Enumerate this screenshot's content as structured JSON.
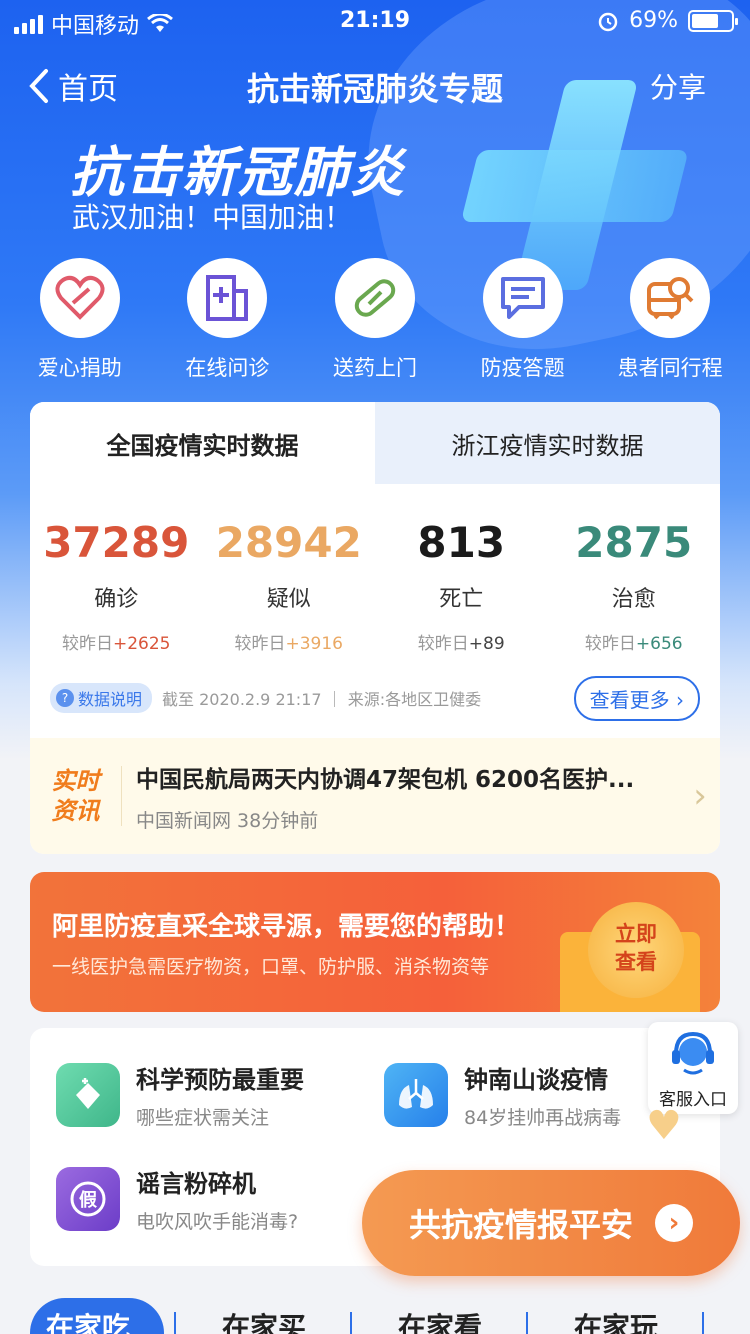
{
  "status_bar": {
    "carrier": "中国移动",
    "time": "21:19",
    "battery": "69%"
  },
  "nav": {
    "back_label": "首页",
    "title": "抗击新冠肺炎专题",
    "share_label": "分享"
  },
  "hero": {
    "title": "抗击新冠肺炎",
    "subtitle": "武汉加油！中国加油！"
  },
  "actions": [
    {
      "label": "爱心捐助",
      "icon": "heart-icon",
      "color": "#e05a6a"
    },
    {
      "label": "在线问诊",
      "icon": "hospital-icon",
      "color": "#6b53d6"
    },
    {
      "label": "送药上门",
      "icon": "pill-icon",
      "color": "#6aa84f"
    },
    {
      "label": "防疫答题",
      "icon": "chat-icon",
      "color": "#5b6ee0"
    },
    {
      "label": "患者同行程",
      "icon": "train-search-icon",
      "color": "#e07b33"
    }
  ],
  "stats": {
    "tabs": [
      "全国疫情实时数据",
      "浙江疫情实时数据"
    ],
    "items": [
      {
        "value": "37289",
        "label": "确诊",
        "delta_prefix": "较昨日",
        "delta": "+2625",
        "color": "#d9553a"
      },
      {
        "value": "28942",
        "label": "疑似",
        "delta_prefix": "较昨日",
        "delta": "+3916",
        "color": "#eaa863"
      },
      {
        "value": "813",
        "label": "死亡",
        "delta_prefix": "较昨日",
        "delta": "+89",
        "color": "#1b1b1b"
      },
      {
        "value": "2875",
        "label": "治愈",
        "delta_prefix": "较昨日",
        "delta": "+656",
        "color": "#3a8a7a"
      }
    ],
    "info_pill": "数据说明",
    "as_of": "截至 2020.2.9 21:17 ｜ 来源:各地区卫健委",
    "more_button": "查看更多"
  },
  "news": {
    "tag_line1": "实时",
    "tag_line2": "资讯",
    "title": "中国民航局两天内协调47架包机 6200名医护...",
    "source": "中国新闻网 38分钟前"
  },
  "banner": {
    "title": "阿里防疫直采全球寻源，需要您的帮助！",
    "subtitle": "一线医护急需医疗物资，口罩、防护服、消杀物资等",
    "button_line1": "立即",
    "button_line2": "查看"
  },
  "topics": [
    {
      "title": "科学预防最重要",
      "subtitle": "哪些症状需关注",
      "icon": "shield-heart-icon"
    },
    {
      "title": "钟南山谈疫情",
      "subtitle": "84岁挂帅再战病毒",
      "icon": "lungs-icon"
    },
    {
      "title": "谣言粉碎机",
      "subtitle": "电吹风吹手能消毒?",
      "icon": "fake-badge-icon"
    }
  ],
  "service": {
    "label": "客服入口"
  },
  "report_button": {
    "label": "共抗疫情报平安"
  },
  "bottom_tabs": [
    "在家吃",
    "在家买",
    "在家看",
    "在家玩"
  ]
}
